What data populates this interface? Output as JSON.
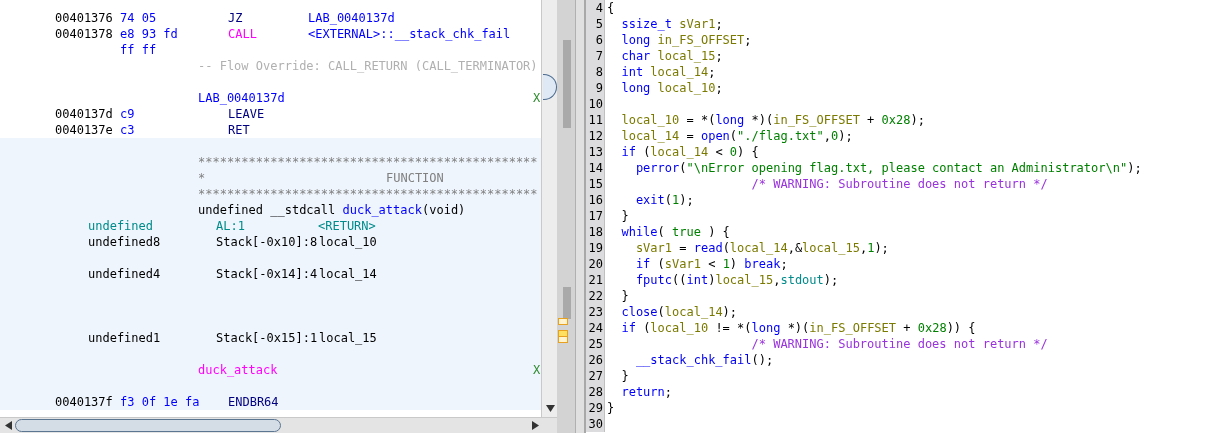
{
  "listing": {
    "sections": [
      {
        "selected": false,
        "rows": [
          {
            "kind": "instr",
            "address": "00401376",
            "bytes": "74 05",
            "mnemonic": {
              "text": "JZ",
              "kind": "plain"
            },
            "operand": "LAB_0040137d"
          },
          {
            "kind": "instr",
            "address": "00401378",
            "bytes": "e8 93 fd",
            "mnemonic": {
              "text": "CALL",
              "kind": "call"
            },
            "operand": "<EXTERNAL>::__stack_chk_fail"
          },
          {
            "kind": "bytes",
            "bytes": "ff ff"
          },
          {
            "kind": "flow",
            "text": "-- Flow Override: CALL_RETURN (CALL_TERMINATOR)"
          },
          {
            "kind": "blank"
          },
          {
            "kind": "label",
            "text": "LAB_0040137d",
            "xref": "X"
          },
          {
            "kind": "instr",
            "address": "0040137d",
            "bytes": "c9",
            "mnemonic": {
              "text": "LEAVE",
              "kind": "plain"
            }
          },
          {
            "kind": "instr",
            "address": "0040137e",
            "bytes": "c3",
            "mnemonic": {
              "text": "RET",
              "kind": "plain"
            }
          }
        ]
      },
      {
        "selected": true,
        "rows": [
          {
            "kind": "blank"
          },
          {
            "kind": "stars",
            "text": "***********************************************"
          },
          {
            "kind": "title",
            "star": "*",
            "text": "FUNCTION"
          },
          {
            "kind": "stars",
            "text": "***********************************************"
          },
          {
            "kind": "signature",
            "prefix": "undefined __stdcall ",
            "name": "duck_attack",
            "args": "(void)"
          },
          {
            "kind": "return_var",
            "type": "undefined",
            "location": "AL:1",
            "name": "<RETURN>"
          },
          {
            "kind": "local_var",
            "type": "undefined8",
            "location": "Stack[-0x10]:8",
            "name": "local_10"
          },
          {
            "kind": "blank"
          },
          {
            "kind": "local_var",
            "type": "undefined4",
            "location": "Stack[-0x14]:4",
            "name": "local_14"
          },
          {
            "kind": "blank"
          },
          {
            "kind": "blank"
          },
          {
            "kind": "blank"
          },
          {
            "kind": "local_var",
            "type": "undefined1",
            "location": "Stack[-0x15]:1",
            "name": "local_15"
          },
          {
            "kind": "blank"
          },
          {
            "kind": "function_label",
            "text": "duck_attack",
            "xref": "X"
          },
          {
            "kind": "blank"
          },
          {
            "kind": "instr",
            "address": "0040137f",
            "bytes": "f3 0f 1e fa",
            "mnemonic": {
              "text": "ENDBR64",
              "kind": "plain"
            }
          }
        ]
      }
    ]
  },
  "decompiler": {
    "lines": [
      {
        "number": "4",
        "tokens": [
          {
            "text": "{",
            "kind": "punct"
          }
        ]
      },
      {
        "number": "5",
        "tokens": [
          {
            "text": "  ssize_t",
            "kind": "type"
          },
          {
            "text": " sVar1",
            "kind": "var"
          },
          {
            "text": ";",
            "kind": "punct"
          }
        ]
      },
      {
        "number": "6",
        "tokens": [
          {
            "text": "  long",
            "kind": "type"
          },
          {
            "text": " in_FS_OFFSET",
            "kind": "var"
          },
          {
            "text": ";",
            "kind": "punct"
          }
        ]
      },
      {
        "number": "7",
        "tokens": [
          {
            "text": "  char",
            "kind": "type"
          },
          {
            "text": " local_15",
            "kind": "var"
          },
          {
            "text": ";",
            "kind": "punct"
          }
        ]
      },
      {
        "number": "8",
        "tokens": [
          {
            "text": "  int",
            "kind": "type"
          },
          {
            "text": " local_14",
            "kind": "var"
          },
          {
            "text": ";",
            "kind": "punct"
          }
        ]
      },
      {
        "number": "9",
        "tokens": [
          {
            "text": "  long",
            "kind": "type"
          },
          {
            "text": " local_10",
            "kind": "var"
          },
          {
            "text": ";",
            "kind": "punct"
          }
        ]
      },
      {
        "number": "10"
      },
      {
        "number": "11",
        "tokens": [
          {
            "text": "  local_10",
            "kind": "var"
          },
          {
            "text": " = *(",
            "kind": "punct"
          },
          {
            "text": "long",
            "kind": "type"
          },
          {
            "text": " *)(",
            "kind": "punct"
          },
          {
            "text": "in_FS_OFFSET",
            "kind": "var"
          },
          {
            "text": " + ",
            "kind": "punct"
          },
          {
            "text": "0x28",
            "kind": "num"
          },
          {
            "text": ");",
            "kind": "punct"
          }
        ]
      },
      {
        "number": "12",
        "tokens": [
          {
            "text": "  local_14",
            "kind": "var"
          },
          {
            "text": " = ",
            "kind": "punct"
          },
          {
            "text": "open",
            "kind": "func"
          },
          {
            "text": "(",
            "kind": "punct"
          },
          {
            "text": "\"./flag.txt\"",
            "kind": "str"
          },
          {
            "text": ",",
            "kind": "punct"
          },
          {
            "text": "0",
            "kind": "num"
          },
          {
            "text": ");",
            "kind": "punct"
          }
        ]
      },
      {
        "number": "13",
        "tokens": [
          {
            "text": "  if",
            "kind": "kw"
          },
          {
            "text": " (",
            "kind": "punct"
          },
          {
            "text": "local_14",
            "kind": "var"
          },
          {
            "text": " < ",
            "kind": "punct"
          },
          {
            "text": "0",
            "kind": "num"
          },
          {
            "text": ") {",
            "kind": "punct"
          }
        ]
      },
      {
        "number": "14",
        "tokens": [
          {
            "text": "    perror",
            "kind": "func"
          },
          {
            "text": "(",
            "kind": "punct"
          },
          {
            "text": "\"\\nError opening flag.txt, please contact an Administrator\\n\"",
            "kind": "str"
          },
          {
            "text": ");",
            "kind": "punct"
          }
        ]
      },
      {
        "number": "15",
        "tokens": [
          {
            "text": "                    /* WARNING: Subroutine does not return */",
            "kind": "comment"
          }
        ]
      },
      {
        "number": "16",
        "tokens": [
          {
            "text": "    exit",
            "kind": "func"
          },
          {
            "text": "(",
            "kind": "punct"
          },
          {
            "text": "1",
            "kind": "num"
          },
          {
            "text": ");",
            "kind": "punct"
          }
        ]
      },
      {
        "number": "17",
        "tokens": [
          {
            "text": "  }",
            "kind": "punct"
          }
        ]
      },
      {
        "number": "18",
        "tokens": [
          {
            "text": "  while",
            "kind": "kw"
          },
          {
            "text": "( ",
            "kind": "punct"
          },
          {
            "text": "true",
            "kind": "num"
          },
          {
            "text": " ) {",
            "kind": "punct"
          }
        ]
      },
      {
        "number": "19",
        "tokens": [
          {
            "text": "    sVar1",
            "kind": "var"
          },
          {
            "text": " = ",
            "kind": "punct"
          },
          {
            "text": "read",
            "kind": "func"
          },
          {
            "text": "(",
            "kind": "punct"
          },
          {
            "text": "local_14",
            "kind": "var"
          },
          {
            "text": ",&",
            "kind": "punct"
          },
          {
            "text": "local_15",
            "kind": "var"
          },
          {
            "text": ",",
            "kind": "punct"
          },
          {
            "text": "1",
            "kind": "num"
          },
          {
            "text": ");",
            "kind": "punct"
          }
        ]
      },
      {
        "number": "20",
        "tokens": [
          {
            "text": "    if",
            "kind": "kw"
          },
          {
            "text": " (",
            "kind": "punct"
          },
          {
            "text": "sVar1",
            "kind": "var"
          },
          {
            "text": " < ",
            "kind": "punct"
          },
          {
            "text": "1",
            "kind": "num"
          },
          {
            "text": ") ",
            "kind": "punct"
          },
          {
            "text": "break",
            "kind": "kw"
          },
          {
            "text": ";",
            "kind": "punct"
          }
        ]
      },
      {
        "number": "21",
        "tokens": [
          {
            "text": "    fputc",
            "kind": "func"
          },
          {
            "text": "((",
            "kind": "punct"
          },
          {
            "text": "int",
            "kind": "type"
          },
          {
            "text": ")",
            "kind": "punct"
          },
          {
            "text": "local_15",
            "kind": "var"
          },
          {
            "text": ",",
            "kind": "punct"
          },
          {
            "text": "stdout",
            "kind": "global"
          },
          {
            "text": ");",
            "kind": "punct"
          }
        ]
      },
      {
        "number": "22",
        "tokens": [
          {
            "text": "  }",
            "kind": "punct"
          }
        ]
      },
      {
        "number": "23",
        "tokens": [
          {
            "text": "  close",
            "kind": "func"
          },
          {
            "text": "(",
            "kind": "punct"
          },
          {
            "text": "local_14",
            "kind": "var"
          },
          {
            "text": ");",
            "kind": "punct"
          }
        ]
      },
      {
        "number": "24",
        "tokens": [
          {
            "text": "  if",
            "kind": "kw"
          },
          {
            "text": " (",
            "kind": "punct"
          },
          {
            "text": "local_10",
            "kind": "var"
          },
          {
            "text": " != *(",
            "kind": "punct"
          },
          {
            "text": "long",
            "kind": "type"
          },
          {
            "text": " *)(",
            "kind": "punct"
          },
          {
            "text": "in_FS_OFFSET",
            "kind": "var"
          },
          {
            "text": " + ",
            "kind": "punct"
          },
          {
            "text": "0x28",
            "kind": "num"
          },
          {
            "text": ")) {",
            "kind": "punct"
          }
        ]
      },
      {
        "number": "25",
        "tokens": [
          {
            "text": "                    /* WARNING: Subroutine does not return */",
            "kind": "comment"
          }
        ]
      },
      {
        "number": "26",
        "tokens": [
          {
            "text": "    __stack_chk_fail",
            "kind": "func"
          },
          {
            "text": "();",
            "kind": "punct"
          }
        ]
      },
      {
        "number": "27",
        "tokens": [
          {
            "text": "  }",
            "kind": "punct"
          }
        ]
      },
      {
        "number": "28",
        "tokens": [
          {
            "text": "  return",
            "kind": "kw"
          },
          {
            "text": ";",
            "kind": "punct"
          }
        ]
      },
      {
        "number": "29",
        "tokens": [
          {
            "text": "}",
            "kind": "punct"
          }
        ]
      },
      {
        "number": "30"
      }
    ]
  }
}
